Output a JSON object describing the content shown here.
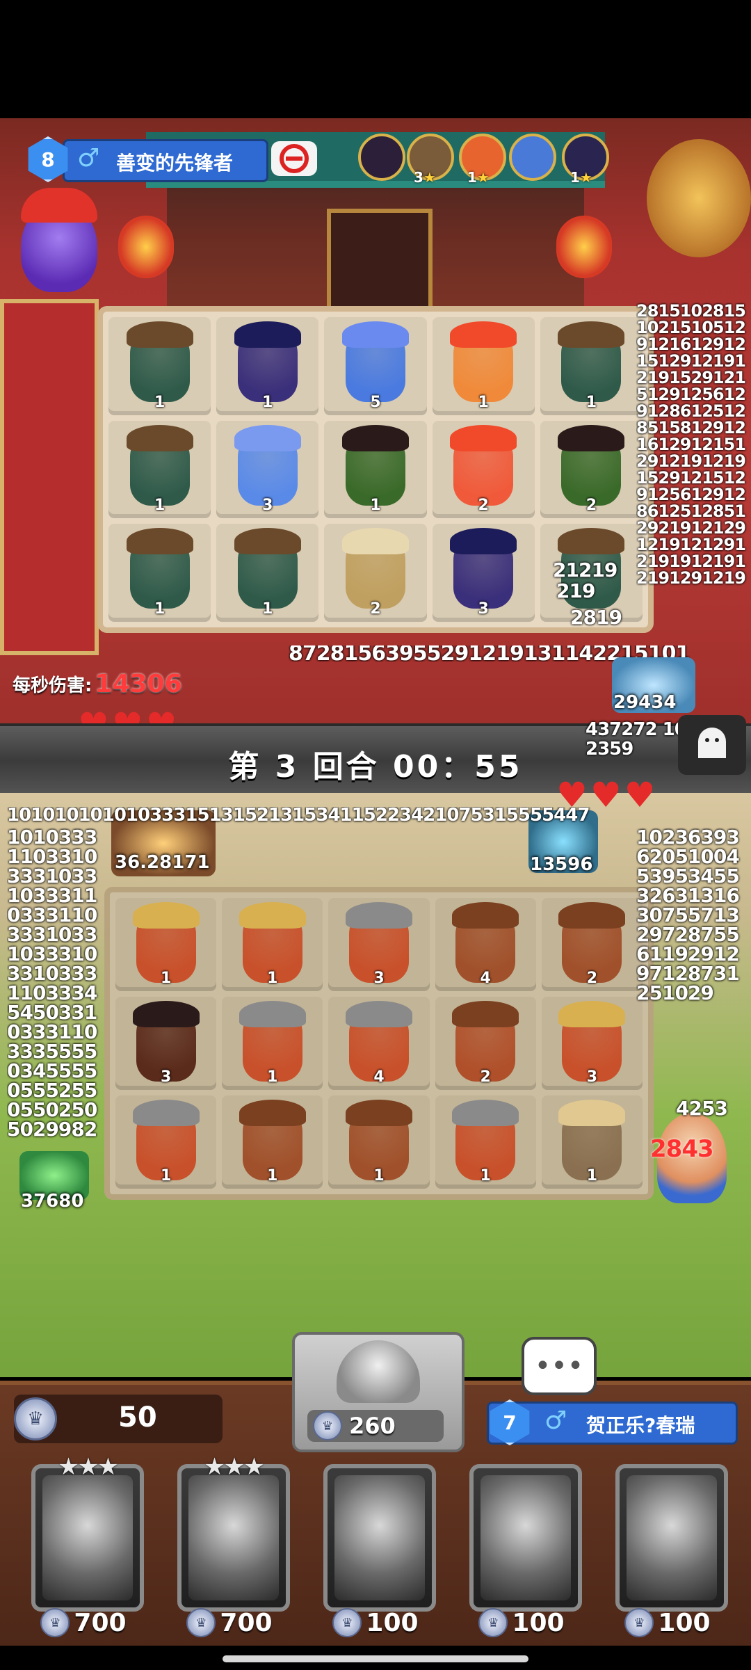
{
  "opponent": {
    "level": "8",
    "gender_icon": "male-icon",
    "name": "善变的先锋者",
    "lineup_stars": [
      "3",
      "1",
      "1"
    ]
  },
  "enemy_board": [
    [
      "1",
      "1",
      "5",
      "1",
      "1"
    ],
    [
      "1",
      "3",
      "1",
      "2",
      "2"
    ],
    [
      "1",
      "1",
      "2",
      "3",
      ""
    ]
  ],
  "enemy_dps": {
    "label": "每秒伤害:",
    "value": "14306"
  },
  "round": {
    "text": "第 3 回合 00：55"
  },
  "towers": {
    "enemy_right": "29434",
    "player_left_top": "36.28171",
    "player_right_top": "13596",
    "player_left_bottom": "37680"
  },
  "player_board": [
    [
      "1",
      "1",
      "3",
      "4",
      "2"
    ],
    [
      "3",
      "1",
      "4",
      "2",
      "3"
    ],
    [
      "1",
      "1",
      "1",
      "1",
      "1"
    ]
  ],
  "damage_text": {
    "enemy_right_spam": "28151028151021510512912161291215129121912191529121512912561291286125128515812912161291215129121912191529121512912561291286125128512921912129121912129121919121912191291219",
    "enemy_left_partial": "21219",
    "enemy_mid_partial": "219",
    "enemy_low_partial": "2819",
    "enemy_row_spam": "87281563955291219131142215101",
    "right_mid_spam": "437272 102359",
    "player_top_spam": "1010101010103331513152131534115223421075315555447",
    "player_left_spam": "1010333110331033310331033311033311033310331033310331033311033345450331033311033355550345555055525505502505029982",
    "player_right_spam": "1023639362051004539534553263131630755713297287556119291297128731251029",
    "player_hero_damage": "2843",
    "player_hero_top": "4253"
  },
  "shop": {
    "coins": "50",
    "refresh_cost": "260",
    "player_level": "7",
    "player_name": "贺正乐?春瑞",
    "chat_icon": "chat-bubble-icon",
    "cards": [
      {
        "stars": "★★★",
        "price": "700"
      },
      {
        "stars": "★★★",
        "price": "700"
      },
      {
        "stars": "",
        "price": "100"
      },
      {
        "stars": "",
        "price": "100"
      },
      {
        "stars": "",
        "price": "100"
      }
    ]
  },
  "colors": {
    "enemy_field": "#b83a36",
    "player_field": "#8fb84f",
    "panel_blue": "#2e6ad1",
    "damage_red": "#ff3030"
  }
}
